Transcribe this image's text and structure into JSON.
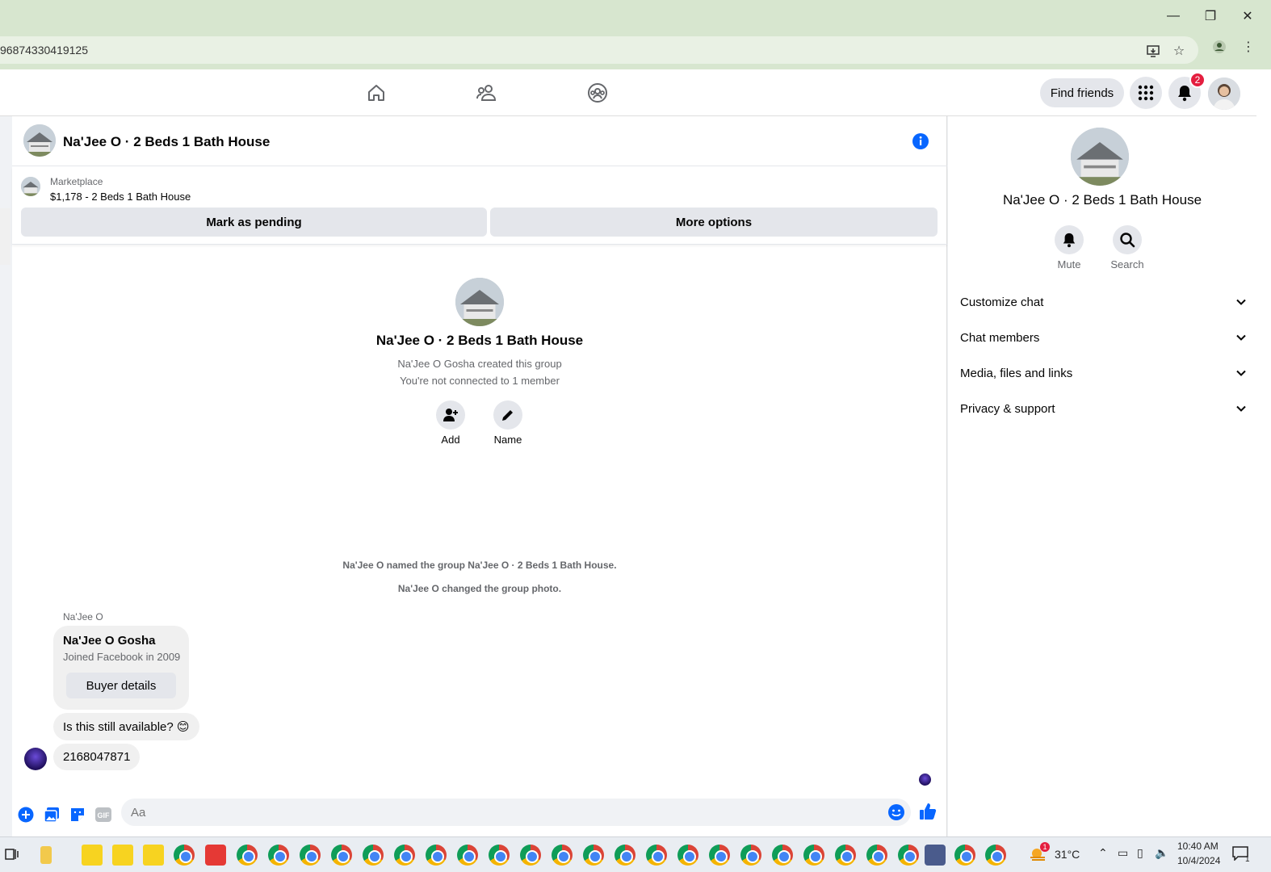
{
  "browser": {
    "url_fragment": "96874330419125",
    "window_controls": {
      "minimize": "—",
      "restore": "❐",
      "close": "✕"
    }
  },
  "fb_nav": {
    "find_friends_label": "Find friends",
    "notification_count": "2"
  },
  "chat": {
    "title": "Na'Jee O · 2 Beds 1 Bath House",
    "marketplace": {
      "label": "Marketplace",
      "item": "$1,178 - 2 Beds 1 Bath House"
    },
    "actions": {
      "mark_pending": "Mark as pending",
      "more_options": "More options"
    },
    "intro": {
      "group_name": "Na'Jee O · 2 Beds 1 Bath House",
      "created_by": "Na'Jee O Gosha created this group",
      "connection": "You're not connected to 1 member",
      "add_label": "Add",
      "name_label": "Name"
    },
    "system_messages": [
      "Na'Jee O named the group Na'Jee O · 2 Beds 1 Bath House.",
      "Na'Jee O changed the group photo."
    ],
    "sender_name": "Na'Jee O",
    "profile_card": {
      "name": "Na'Jee O Gosha",
      "joined": "Joined Facebook in 2009",
      "button": "Buyer details"
    },
    "messages": [
      "Is this still available? 😊",
      "2168047871"
    ],
    "composer": {
      "placeholder": "Aa",
      "gif_label": "GIF"
    }
  },
  "right_panel": {
    "title": "Na'Jee O · 2 Beds 1 Bath House",
    "mute_label": "Mute",
    "search_label": "Search",
    "sections": [
      "Customize chat",
      "Chat members",
      "Media, files and links",
      "Privacy & support"
    ]
  },
  "taskbar": {
    "temperature": "31°C",
    "weather_badge": "1",
    "time": "10:40 AM",
    "date": "10/4/2024",
    "notification_count": "1"
  },
  "colors": {
    "fb_blue": "#0866ff",
    "badge_red": "#e41e3f",
    "chrome_frame": "#d7e6cf"
  }
}
